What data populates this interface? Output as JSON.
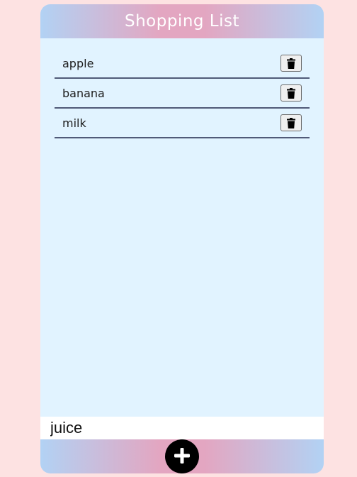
{
  "header": {
    "title": "Shopping List"
  },
  "list": {
    "items": [
      {
        "label": "apple",
        "delete_icon": "trash-icon"
      },
      {
        "label": "banana",
        "delete_icon": "trash-icon"
      },
      {
        "label": "milk",
        "delete_icon": "trash-icon"
      }
    ]
  },
  "new_item": {
    "value": "juice",
    "placeholder": ""
  },
  "footer": {
    "add_icon": "plus-icon"
  },
  "colors": {
    "page_background": "#fde2e2",
    "panel_background": "#e1f3ff",
    "gradient_blue": "#b2d2f4",
    "gradient_pink": "#e3a6c1",
    "divider": "#505a78"
  }
}
